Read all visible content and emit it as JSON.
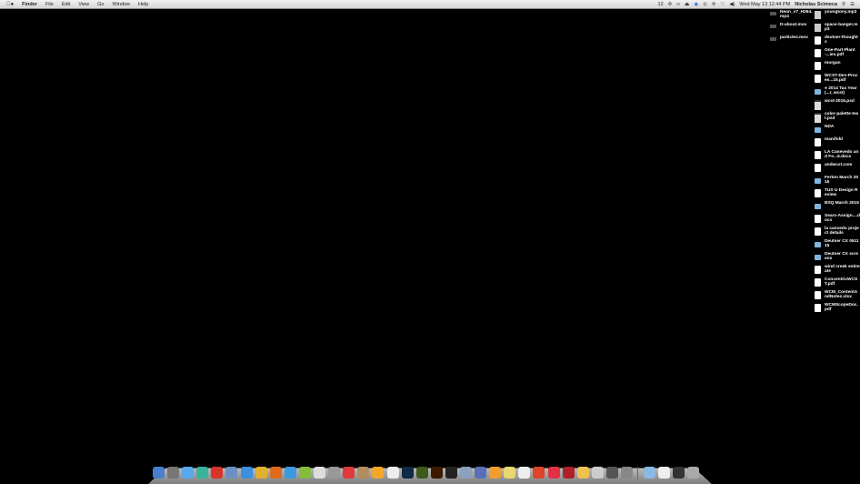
{
  "menubar": {
    "apple": "",
    "app": "Finder",
    "items": [
      "File",
      "Edit",
      "View",
      "Go",
      "Window",
      "Help"
    ]
  },
  "status": {
    "items": [
      "12",
      "✣",
      "∞",
      "⏏",
      "◉",
      "⊙",
      "✢",
      "♡",
      "◀)"
    ],
    "clock": "Wed May 13  12:44 PM",
    "user": "Nicholas Scimeca",
    "search": "⚲",
    "list": "☰"
  },
  "desktop": {
    "left": [
      {
        "label": "Neon_v7_H264.mp4",
        "type": "movie"
      },
      {
        "label": "D-about.mov",
        "type": "movie"
      },
      {
        "label": "particles.mov",
        "type": "movie"
      }
    ],
    "right": [
      {
        "label": "youngtony.mp3",
        "type": "audio"
      },
      {
        "label": "space-banger.mp3",
        "type": "audio"
      },
      {
        "label": "deutser-thoughts",
        "type": "file"
      },
      {
        "label": "One-Part-Plant-...ies.pdf",
        "type": "file"
      },
      {
        "label": "morgan",
        "type": "file"
      },
      {
        "label": "WCST-Dev-Proces...15.pdf",
        "type": "file"
      },
      {
        "label": "● 2014 Tax Year (...r, wcst)",
        "type": "folder"
      },
      {
        "label": "wcst-2015.psd",
        "type": "psd"
      },
      {
        "label": "color-palette-test.psd",
        "type": "psd"
      },
      {
        "label": "NDA",
        "type": "folder"
      },
      {
        "label": "manifold",
        "type": "file"
      },
      {
        "label": "LA Canevedo and Fo...5.docx",
        "type": "file"
      },
      {
        "label": "andwcst.com",
        "type": "file"
      },
      {
        "label": "Ferton March 2015",
        "type": "folder"
      },
      {
        "label": "TUX U Design Review",
        "type": "file"
      },
      {
        "label": "BSQ March 2015",
        "type": "folder"
      },
      {
        "label": "Sears-Assign....docx",
        "type": "file"
      },
      {
        "label": "la canvedo project details",
        "type": "file"
      },
      {
        "label": "Deutser CX 051115",
        "type": "folder"
      },
      {
        "label": "Deutser CX screens",
        "type": "folder"
      },
      {
        "label": "wind creek estimate",
        "type": "file"
      },
      {
        "label": "ConcentricWCST.pdf",
        "type": "file"
      },
      {
        "label": "WCM_ContentAndNotes.xlsx",
        "type": "file"
      },
      {
        "label": "WCMScopeDoc.pdf",
        "type": "file"
      }
    ]
  },
  "dock": {
    "apps": [
      {
        "name": "finder",
        "color": "#4a7fd0"
      },
      {
        "name": "launchpad",
        "color": "#777"
      },
      {
        "name": "messages",
        "color": "#5aa9f0"
      },
      {
        "name": "slack",
        "color": "#3ab39a"
      },
      {
        "name": "wunderlist",
        "color": "#d9332c"
      },
      {
        "name": "preview",
        "color": "#6b8fc4"
      },
      {
        "name": "safari",
        "color": "#3d8fe0"
      },
      {
        "name": "chrome",
        "color": "#e0b22e"
      },
      {
        "name": "firefox",
        "color": "#e06a1c"
      },
      {
        "name": "twitter",
        "color": "#3a9be0"
      },
      {
        "name": "spotify",
        "color": "#84bd3a"
      },
      {
        "name": "script-editor",
        "color": "#ddd"
      },
      {
        "name": "calculator",
        "color": "#999"
      },
      {
        "name": "opera",
        "color": "#e03a3a"
      },
      {
        "name": "notefile",
        "color": "#b08d60"
      },
      {
        "name": "sketch",
        "color": "#f2a92b"
      },
      {
        "name": "acrobat",
        "color": "#eee"
      },
      {
        "name": "photoshop",
        "color": "#0f2a44"
      },
      {
        "name": "dreamweaver",
        "color": "#3d5a1a"
      },
      {
        "name": "illustrator",
        "color": "#3b1a00"
      },
      {
        "name": "ellipsis-app",
        "color": "#222"
      },
      {
        "name": "iphoto",
        "color": "#8aa2c0"
      },
      {
        "name": "transmit",
        "color": "#5a6fb8"
      },
      {
        "name": "adium",
        "color": "#f29d2b"
      },
      {
        "name": "stickies",
        "color": "#e8d870"
      },
      {
        "name": "reminders",
        "color": "#eee"
      },
      {
        "name": "infinity-app",
        "color": "#e0432b"
      },
      {
        "name": "itunes",
        "color": "#e23045"
      },
      {
        "name": "photo-booth",
        "color": "#b0202a"
      },
      {
        "name": "pages",
        "color": "#f0c050"
      },
      {
        "name": "tubes",
        "color": "#ccc"
      },
      {
        "name": "wordpress",
        "color": "#555"
      },
      {
        "name": "system-preferences",
        "color": "#888"
      }
    ],
    "others": [
      {
        "name": "applications-folder",
        "color": "#8ab8e0"
      },
      {
        "name": "documents-stack",
        "color": "#eee"
      },
      {
        "name": "screen-stack",
        "color": "#333"
      },
      {
        "name": "trash",
        "color": "#aaa"
      }
    ]
  }
}
